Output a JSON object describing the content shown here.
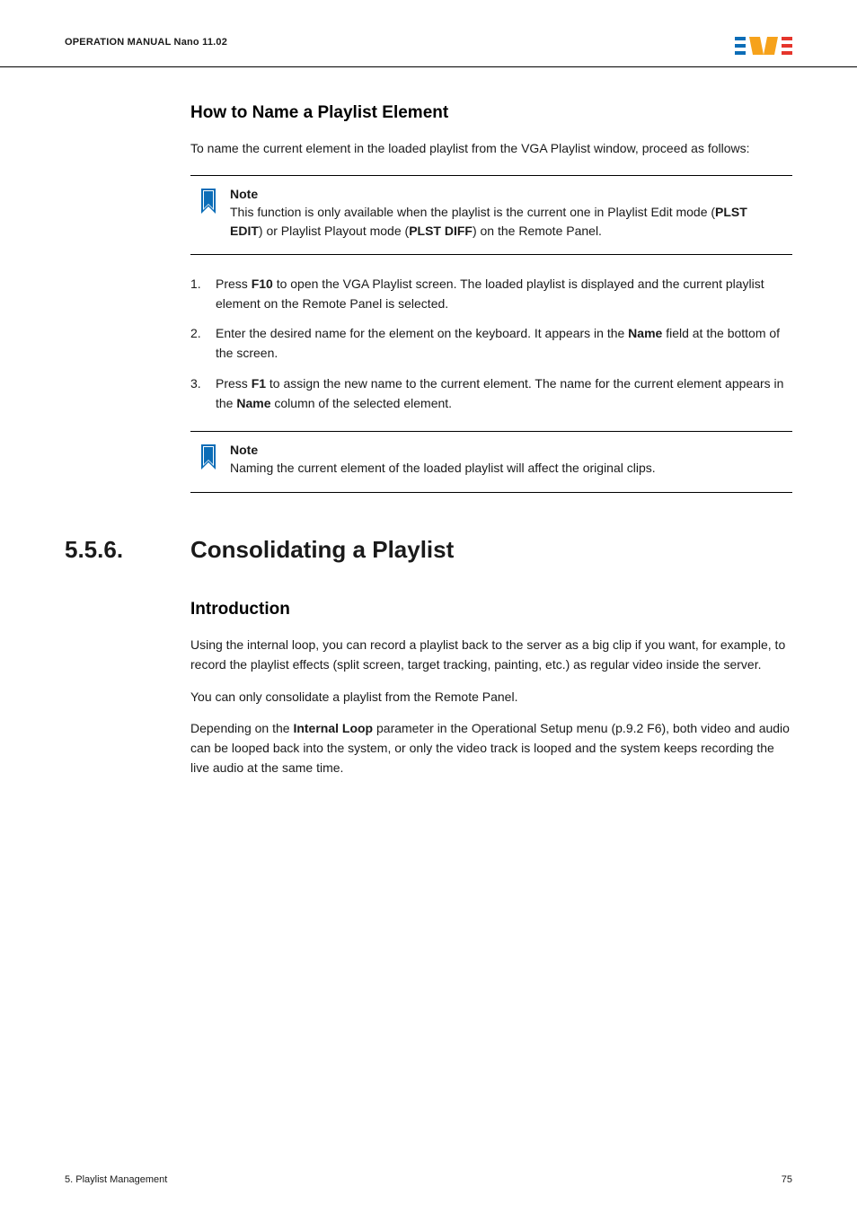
{
  "header": {
    "manual_label": "OPERATION MANUAL  Nano 11.02"
  },
  "logo": {
    "colors": {
      "blue": "#0b6db7",
      "orange": "#f6a21b",
      "red": "#e5352c"
    }
  },
  "howto": {
    "heading": "How to Name a Playlist Element",
    "intro": "To name the current element in the loaded playlist from the VGA Playlist window, proceed as follows:",
    "note1": {
      "title": "Note",
      "body_pre": "This function is only available when the playlist is the current one in Playlist Edit mode (",
      "b1": "PLST EDIT",
      "body_mid": ") or Playlist Playout mode (",
      "b2": "PLST DIFF",
      "body_post": ") on the Remote Panel."
    },
    "steps": {
      "s1_pre": "Press ",
      "s1_b": "F10",
      "s1_post": " to open the VGA Playlist screen. The loaded playlist is displayed and the current playlist element on the Remote Panel is selected.",
      "s2_pre": "Enter the desired name for the element on the keyboard. It appears in the ",
      "s2_b": "Name",
      "s2_post": " field at the bottom of the screen.",
      "s3_pre": "Press ",
      "s3_b1": "F1",
      "s3_mid": " to assign the new name to the current element. The name for the current element appears in the ",
      "s3_b2": "Name",
      "s3_post": " column of the selected element."
    },
    "note2": {
      "title": "Note",
      "body": "Naming the current element of the loaded playlist will affect the original clips."
    }
  },
  "section": {
    "number": "5.5.6.",
    "title": "Consolidating a Playlist",
    "intro_heading": "Introduction",
    "p1": "Using the internal loop, you can record a playlist back to the server as a big clip if you want, for example, to record the playlist effects (split screen, target tracking, painting, etc.) as regular video inside the server.",
    "p2": "You can only consolidate a playlist from the Remote Panel.",
    "p3_pre": "Depending on the ",
    "p3_b": "Internal  Loop",
    "p3_post": " parameter in the Operational Setup menu (p.9.2 F6), both video and audio can be looped back into the system, or only the video track is looped and the system keeps recording the live audio at the same time."
  },
  "footer": {
    "left": "5. Playlist Management",
    "right": "75"
  }
}
